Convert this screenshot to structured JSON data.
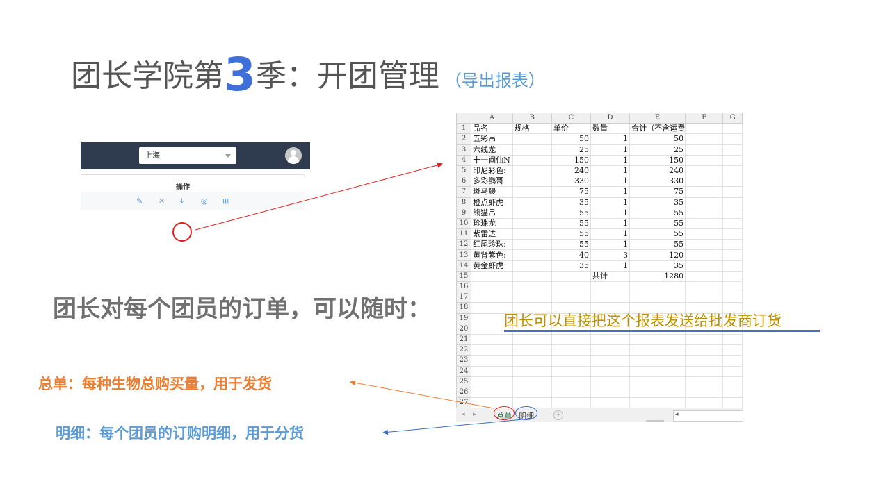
{
  "title": {
    "main_prefix": "团长学院第",
    "number": "3",
    "main_suffix": "季：开团管理",
    "sub": "（导出报表）"
  },
  "app": {
    "city_select": "上海",
    "column_header": "操作",
    "icons": [
      "edit-icon",
      "close-icon",
      "download-icon",
      "view-icon",
      "grid-icon"
    ]
  },
  "statement": "团长对每个团员的订单，可以随时：",
  "labels": {
    "total": "总单：每种生物总购买量，用于发货",
    "detail": "明细：每个团员的订购明细，用于分货"
  },
  "note": "团长可以直接把这个报表发送给批发商订货",
  "spreadsheet": {
    "columns": [
      "A",
      "B",
      "C",
      "D",
      "E",
      "F",
      "G"
    ],
    "header": [
      "品名",
      "规格",
      "单价",
      "数量",
      "合计（不含运费"
    ],
    "rows": [
      {
        "name": "五彩吊",
        "price": "50",
        "qty": "1",
        "total": "50"
      },
      {
        "name": "六线龙",
        "price": "25",
        "qty": "1",
        "total": "25"
      },
      {
        "name": "十一间仙N",
        "price": "150",
        "qty": "1",
        "total": "150"
      },
      {
        "name": "印尼彩色:",
        "price": "240",
        "qty": "1",
        "total": "240"
      },
      {
        "name": "多彩鹦哥",
        "price": "330",
        "qty": "1",
        "total": "330"
      },
      {
        "name": "斑马鳗",
        "price": "75",
        "qty": "1",
        "total": "75"
      },
      {
        "name": "橙点虾虎",
        "price": "35",
        "qty": "1",
        "total": "35"
      },
      {
        "name": "熊猫吊",
        "price": "55",
        "qty": "1",
        "total": "55"
      },
      {
        "name": "珍珠龙",
        "price": "55",
        "qty": "1",
        "total": "55"
      },
      {
        "name": "紫雷达",
        "price": "55",
        "qty": "1",
        "total": "55"
      },
      {
        "name": "红尾珍珠:",
        "price": "55",
        "qty": "1",
        "total": "55"
      },
      {
        "name": "黄背紫色:",
        "price": "40",
        "qty": "3",
        "total": "120"
      },
      {
        "name": "黄金虾虎",
        "price": "35",
        "qty": "1",
        "total": "35"
      }
    ],
    "sum_label": "共计",
    "sum_value": "1280",
    "total_rows": 28,
    "tabs": [
      "总单",
      "明细"
    ]
  },
  "colors": {
    "title": "#555555",
    "accent_blue": "#3f6fd8",
    "orange": "#ed7d31",
    "light_blue": "#5b9bd5",
    "gold": "#bf9000",
    "red": "#e02020",
    "app_bar": "#2f3c4f"
  }
}
